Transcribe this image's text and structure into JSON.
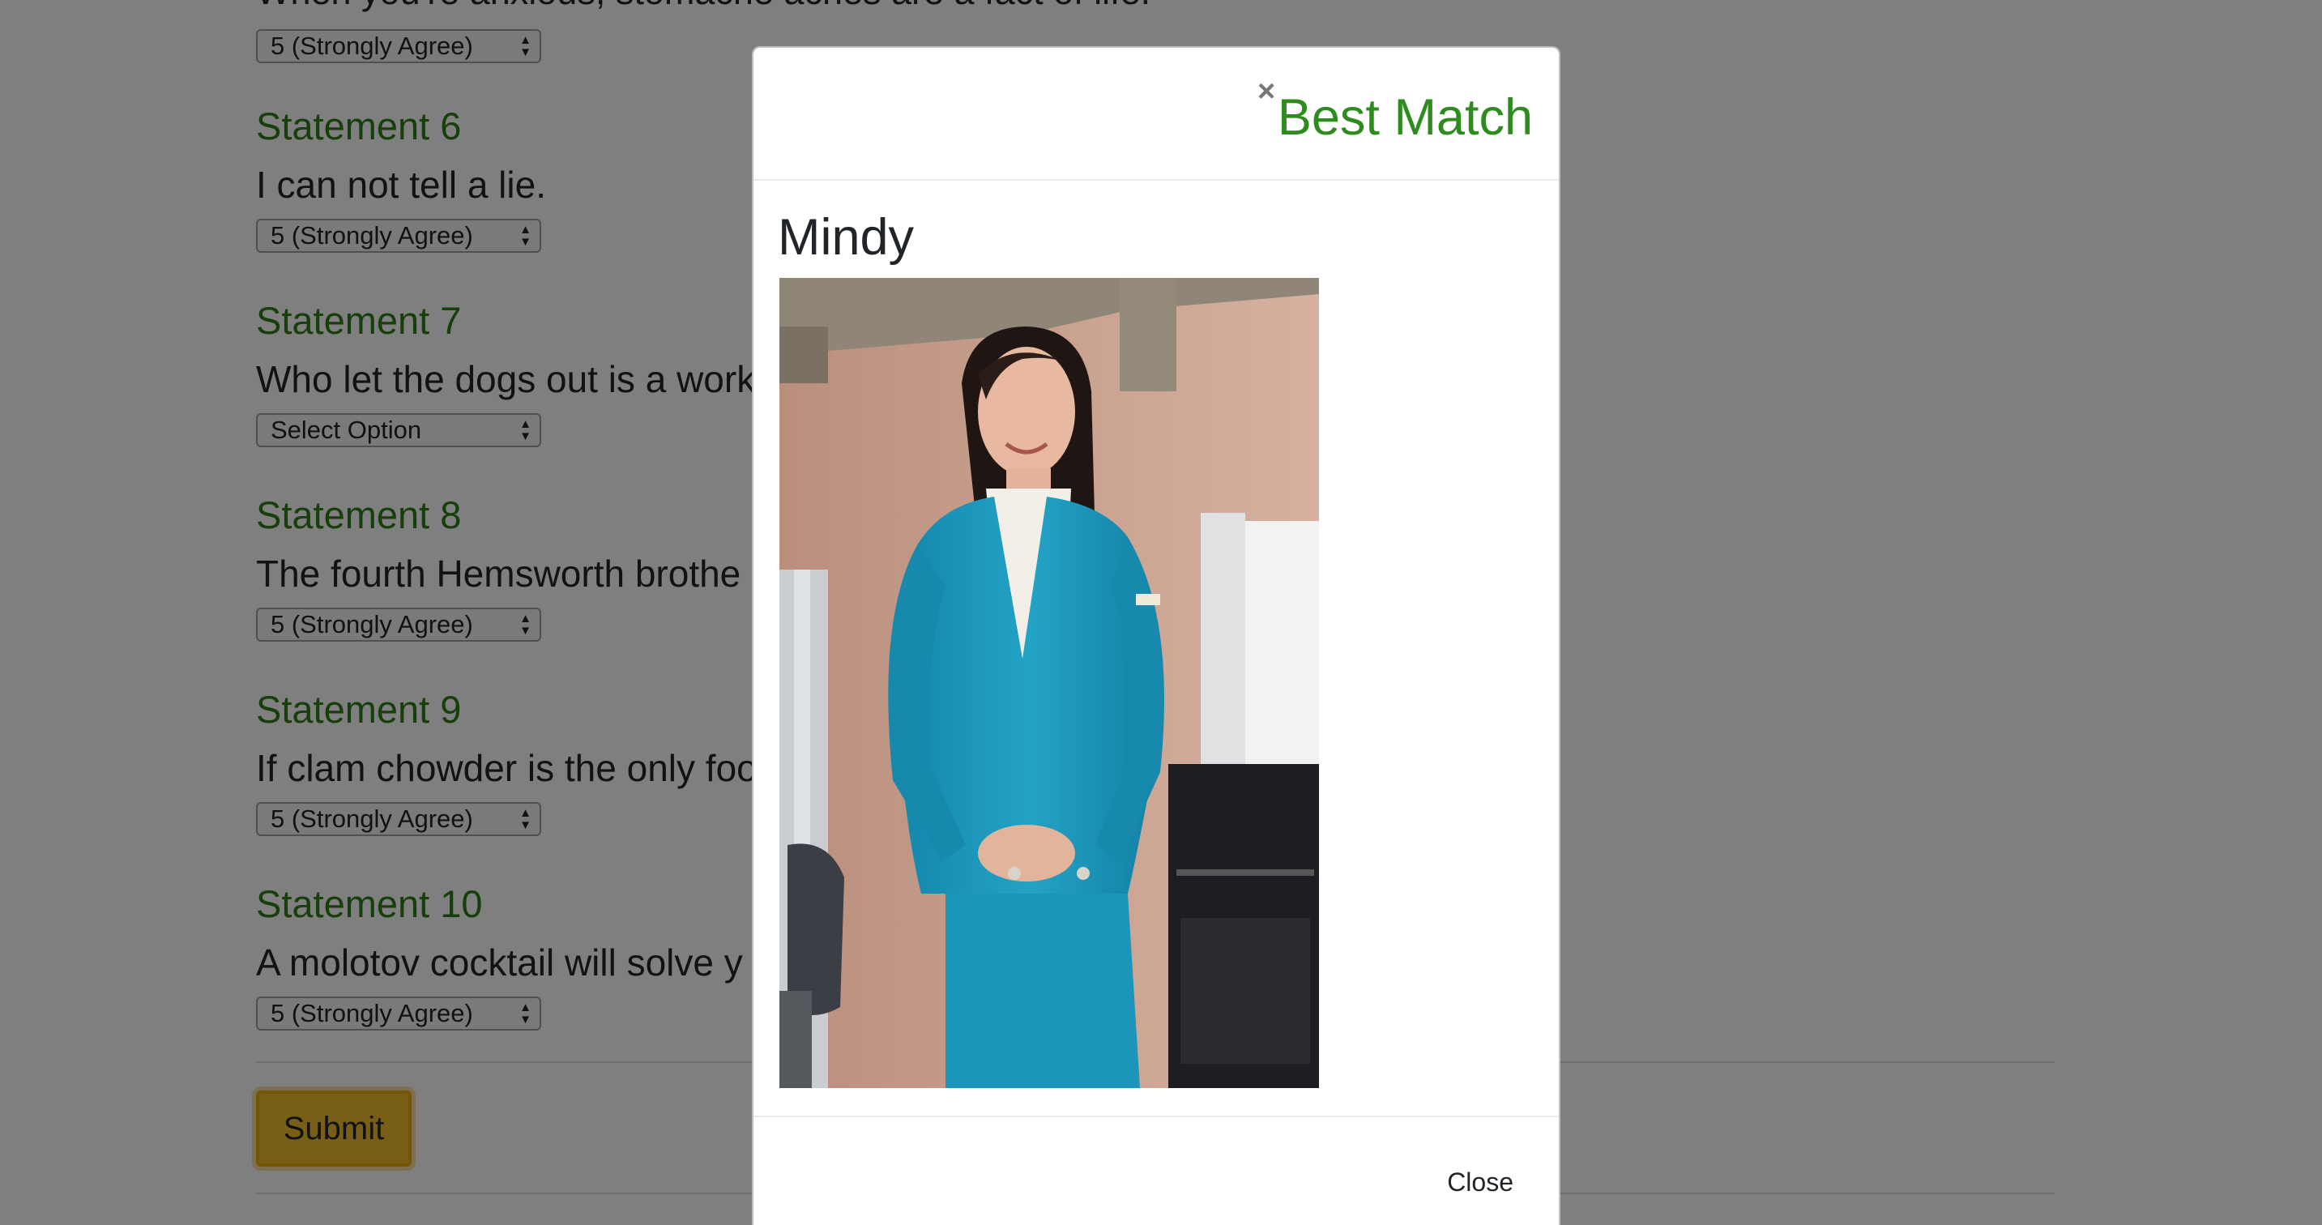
{
  "survey": {
    "partial_statement_text": "When you're anxious, stomache aches are a fact of life.",
    "partial_statement_answer": "5 (Strongly Agree)",
    "statements": [
      {
        "title": "Statement 6",
        "text": "I can not tell a lie.",
        "answer": "5 (Strongly Agree)"
      },
      {
        "title": "Statement 7",
        "text": "Who let the dogs out is a work",
        "answer": "Select Option"
      },
      {
        "title": "Statement 8",
        "text": "The fourth Hemsworth brothe",
        "answer": "5 (Strongly Agree)"
      },
      {
        "title": "Statement 9",
        "text": "If clam chowder is the only foo",
        "answer": "5 (Strongly Agree)"
      },
      {
        "title": "Statement 10",
        "text": "A molotov cocktail will solve y",
        "answer": "5 (Strongly Agree)"
      }
    ],
    "submit_label": "Submit"
  },
  "modal": {
    "close_icon": "×",
    "title": "Best Match",
    "match_name": "Mindy",
    "photo_alt": "Photo of Mindy",
    "close_label": "Close"
  },
  "colors": {
    "heading_green": "#2e7d17",
    "title_green": "#2e8b1e",
    "submit_yellow": "#f0bd2f",
    "backdrop": "rgba(0,0,0,0.5)",
    "suit_teal": "#1a9abf"
  }
}
